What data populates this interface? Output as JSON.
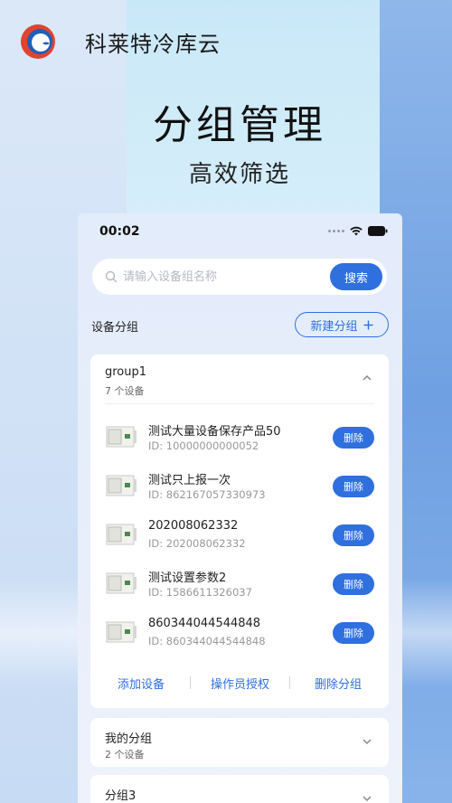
{
  "brand": {
    "name": "科莱特冷库云"
  },
  "hero": {
    "title": "分组管理",
    "subtitle": "高效筛选"
  },
  "phone": {
    "status_time": "00:02",
    "search": {
      "placeholder": "请输入设备组名称",
      "button_label": "搜索"
    },
    "section_title": "设备分组",
    "new_group_label": "新建分组",
    "groups": [
      {
        "name": "group1",
        "count": "7 个设备",
        "expanded": true,
        "devices": [
          {
            "name": "测试大量设备保存产品50",
            "id": "ID: 10000000000052",
            "action": "删除"
          },
          {
            "name": "测试只上报一次",
            "id": "ID: 862167057330973",
            "action": "删除"
          },
          {
            "name": "202008062332",
            "id": "ID: 202008062332",
            "action": "删除"
          },
          {
            "name": "测试设置参数2",
            "id": "ID: 1586611326037",
            "action": "删除"
          },
          {
            "name": "860344044544848",
            "id": "ID: 860344044544848",
            "action": "删除"
          }
        ],
        "actions": [
          "添加设备",
          "操作员授权",
          "删除分组"
        ]
      },
      {
        "name": "我的分组",
        "count": "2 个设备",
        "expanded": false
      },
      {
        "name": "分组3",
        "count": "",
        "expanded": false
      }
    ]
  },
  "colors": {
    "accent": "#2f6fde",
    "logo_red": "#e0432f",
    "logo_blue": "#1f5fb8"
  }
}
